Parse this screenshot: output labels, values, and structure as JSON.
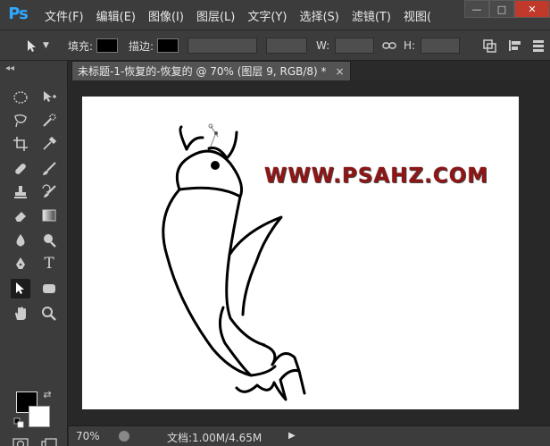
{
  "app": {
    "logo": "Ps"
  },
  "menubar": {
    "items": [
      "文件(F)",
      "编辑(E)",
      "图像(I)",
      "图层(L)",
      "文字(Y)",
      "选择(S)",
      "滤镜(T)",
      "视图("
    ]
  },
  "window_controls": {
    "minimize": "—",
    "restore": "□",
    "close": "✕"
  },
  "options": {
    "fill_label": "填充:",
    "stroke_label": "描边:",
    "w_label": "W:",
    "h_label": "H:"
  },
  "document": {
    "tab_title": "未标题-1-恢复的-恢复的 @ 70% (图层 9, RGB/8) *",
    "tab_close": "×",
    "watermark": "WWW.PSAHZ.COM"
  },
  "status": {
    "zoom": "70%",
    "doc_info": "文档:1.00M/4.65M",
    "arrow": "▶"
  },
  "colors": {
    "foreground": "#000000",
    "background": "#ffffff",
    "watermark": "#8e1616",
    "accent": "#31a8ff"
  },
  "icons": [
    "move-tool-icon",
    "marquee-icon",
    "lasso-icon",
    "crop-icon",
    "eyedropper-icon",
    "healing-icon",
    "brush-icon",
    "stamp-icon",
    "eraser-icon",
    "gradient-icon",
    "blur-icon",
    "dodge-icon",
    "pen-icon",
    "type-icon",
    "path-selection-icon",
    "shape-icon",
    "hand-icon",
    "zoom-icon"
  ]
}
